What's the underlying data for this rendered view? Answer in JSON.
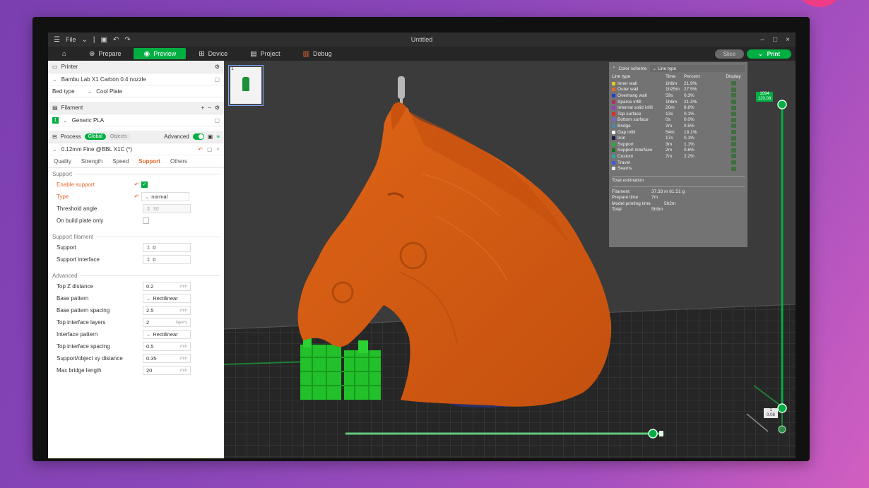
{
  "titlebar": {
    "file_menu": "File",
    "title": "Untitled",
    "window_controls": [
      "–",
      "□",
      "×"
    ]
  },
  "tabs": [
    {
      "label": "Prepare",
      "icon": "target-icon"
    },
    {
      "label": "Preview",
      "icon": "eye-icon",
      "active": true
    },
    {
      "label": "Device",
      "icon": "device-icon"
    },
    {
      "label": "Project",
      "icon": "project-icon"
    },
    {
      "label": "Debug",
      "icon": "debug-icon"
    }
  ],
  "actions": {
    "slice": "Slice",
    "print": "Print"
  },
  "sidebar": {
    "printer": {
      "title": "Printer",
      "model": "Bambu Lab X1 Carbon 0.4 nozzle",
      "bed_type_label": "Bed type",
      "bed_type_value": "Cool Plate"
    },
    "filament": {
      "title": "Filament",
      "slot": "1",
      "name": "Generic PLA"
    },
    "process": {
      "title": "Process",
      "global_label": "Global",
      "objects_label": "Objects",
      "advanced_label": "Advanced",
      "preset": "0.12mm Fine @BBL X1C (*)",
      "subtabs": [
        "Quality",
        "Strength",
        "Speed",
        "Support",
        "Others"
      ]
    },
    "support_group": {
      "title": "Support",
      "enable_support": "Enable support",
      "type_label": "Type",
      "type_value": "normal",
      "threshold_label": "Threshold angle",
      "threshold_value": "30",
      "build_plate_only": "On build plate only"
    },
    "support_filament_group": {
      "title": "Support filament",
      "support_label": "Support",
      "support_value": "0",
      "interface_label": "Support interface",
      "interface_value": "0"
    },
    "advanced_group": {
      "title": "Advanced",
      "rows": [
        {
          "label": "Top Z distance",
          "value": "0.2",
          "unit": "mm"
        },
        {
          "label": "Base pattern",
          "value": "Rectilinear",
          "unit": ""
        },
        {
          "label": "Base pattern spacing",
          "value": "2.5",
          "unit": "mm"
        },
        {
          "label": "Top interface layers",
          "value": "2",
          "unit": "layers"
        },
        {
          "label": "Interface pattern",
          "value": "Rectilinear",
          "unit": ""
        },
        {
          "label": "Top interface spacing",
          "value": "0.5",
          "unit": "mm"
        },
        {
          "label": "Support/object xy distance",
          "value": "0.35",
          "unit": "mm"
        },
        {
          "label": "Max bridge length",
          "value": "20",
          "unit": "mm"
        }
      ]
    }
  },
  "viewport": {
    "plate_thumb_label": "1",
    "layer_top_label": "1094\n120.08",
    "layer_bottom_label": "1\n0.08",
    "layer_progress": 1.0,
    "move_progress": 0.98
  },
  "legend": {
    "title": "Color scheme",
    "scheme_value": "Line type",
    "columns": [
      "Line type",
      "Time",
      "Percent",
      "Display"
    ],
    "rows": [
      {
        "name": "Inner wall",
        "time": "1h6m",
        "percent": "21.9%",
        "color": "#e8c81c"
      },
      {
        "name": "Outer wall",
        "time": "1h25m",
        "percent": "27.5%",
        "color": "#e8672f"
      },
      {
        "name": "Overhang wall",
        "time": "59s",
        "percent": "0.3%",
        "color": "#1f3fd0"
      },
      {
        "name": "Sparse infill",
        "time": "1h6m",
        "percent": "21.3%",
        "color": "#b02b6a"
      },
      {
        "name": "Internal solid infill",
        "time": "20m",
        "percent": "6.6%",
        "color": "#9a3fb8"
      },
      {
        "name": "Top surface",
        "time": "13s",
        "percent": "0.1%",
        "color": "#e02b2b"
      },
      {
        "name": "Bottom surface",
        "time": "0s",
        "percent": "0.0%",
        "color": "#6a6ad0"
      },
      {
        "name": "Bridge",
        "time": "2m",
        "percent": "0.5%",
        "color": "#4a8aa8"
      },
      {
        "name": "Gap infill",
        "time": "54m",
        "percent": "18.1%",
        "color": "#ffffff"
      },
      {
        "name": "Iron",
        "time": "17s",
        "percent": "0.1%",
        "color": "#1a1a4a"
      },
      {
        "name": "Support",
        "time": "3m",
        "percent": "1.1%",
        "color": "#22b22f"
      },
      {
        "name": "Support interface",
        "time": "2m",
        "percent": "0.6%",
        "color": "#1f6f1f"
      },
      {
        "name": "Custom",
        "time": "7m",
        "percent": "2.2%",
        "color": "#2fa8a0"
      },
      {
        "name": "Travel",
        "time": "",
        "percent": "",
        "color": "#3a5adf"
      },
      {
        "name": "Seams",
        "time": "",
        "percent": "",
        "color": "#e6e6e6"
      }
    ],
    "total_estimation_label": "Total estimation",
    "estimates": [
      {
        "key": "Filament",
        "value": "37.33 m    81.51 g"
      },
      {
        "key": "Prepare time",
        "value": "7m"
      },
      {
        "key": "Model printing time",
        "value": "5h2m"
      },
      {
        "key": "Total",
        "value": "5h9m"
      }
    ]
  },
  "colors": {
    "accent": "#00ae42",
    "model": "#d25a14",
    "support": "#22c02a",
    "warning": "#e8672f"
  }
}
